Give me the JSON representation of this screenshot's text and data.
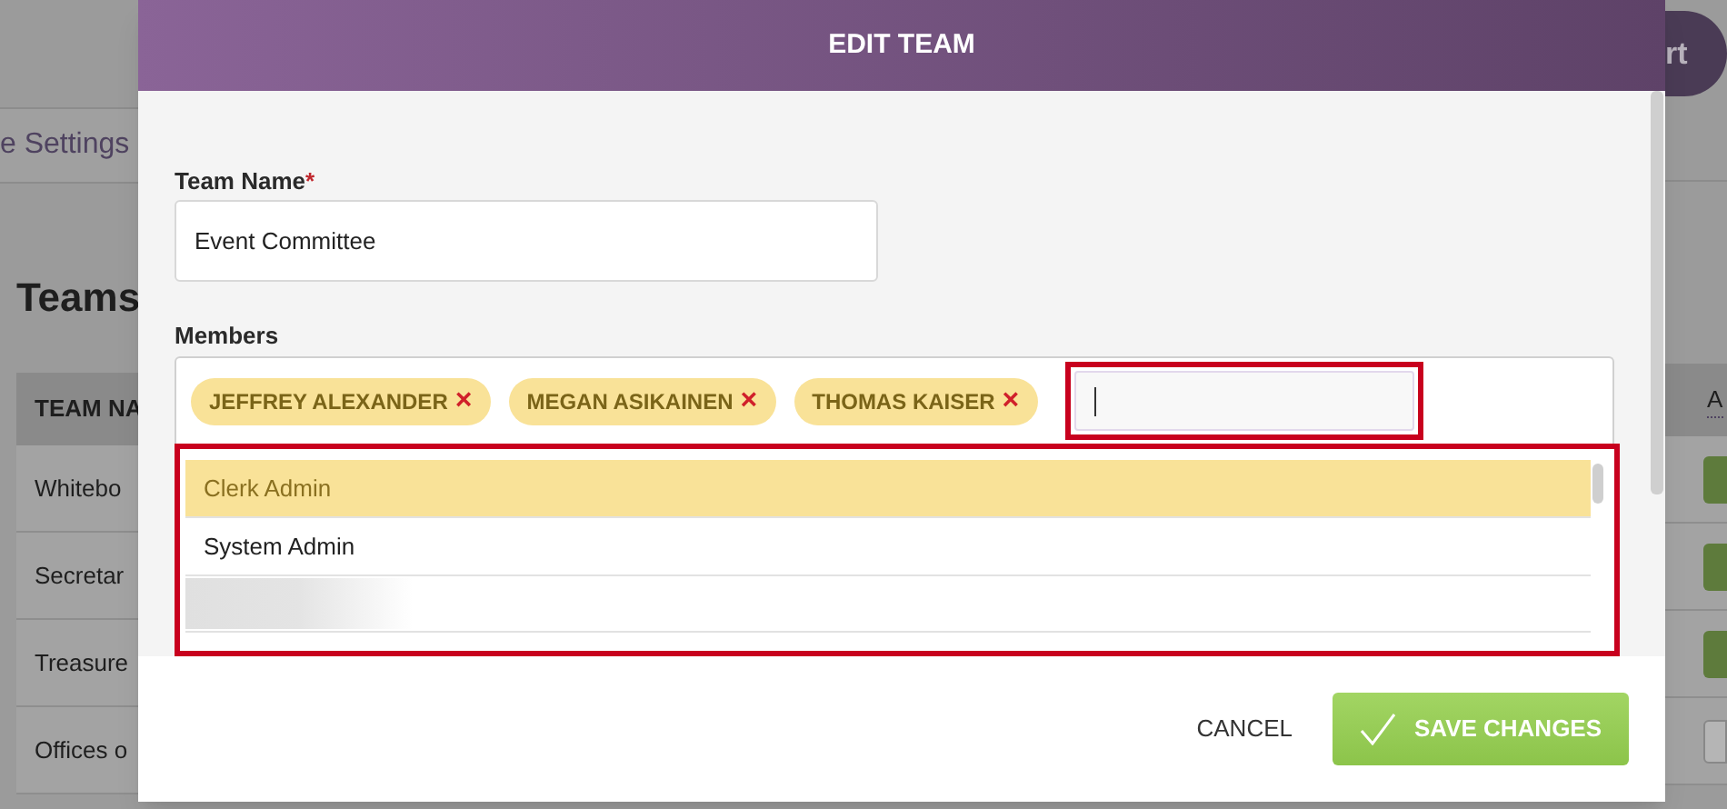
{
  "background": {
    "breadcrumb": "e Settings",
    "heading": "Teams",
    "action_button": "rt",
    "table": {
      "columns": [
        "TEAM NA",
        "A"
      ],
      "rows": [
        {
          "name": "Whitebo",
          "on": true
        },
        {
          "name": "Secretar",
          "on": true
        },
        {
          "name": "Treasure",
          "on": true
        },
        {
          "name": "Offices o",
          "on": false
        }
      ]
    }
  },
  "dialog": {
    "title": "EDIT TEAM",
    "team_name": {
      "label": "Team Name",
      "required_mark": "*",
      "value": "Event Committee"
    },
    "members": {
      "label": "Members",
      "tags": [
        {
          "label": "JEFFREY ALEXANDER",
          "remove": "×"
        },
        {
          "label": "MEGAN ASIKAINEN",
          "remove": "×"
        },
        {
          "label": "THOMAS KAISER",
          "remove": "×"
        }
      ],
      "options": [
        {
          "kind": "text",
          "label": "Clerk Admin",
          "selected": true
        },
        {
          "kind": "text",
          "label": "System Admin",
          "selected": false
        },
        {
          "kind": "redacted",
          "selected": false
        }
      ]
    },
    "buttons": [
      {
        "kind": "cancel",
        "label": "CANCEL"
      },
      {
        "kind": "save",
        "label": "SAVE CHANGES"
      }
    ]
  }
}
